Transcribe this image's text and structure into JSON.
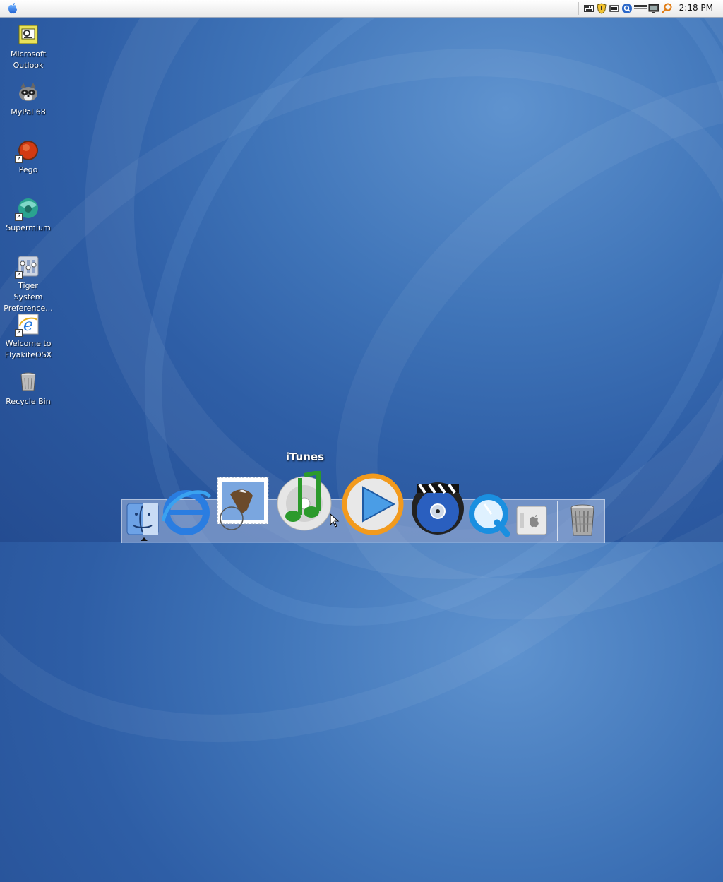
{
  "menubar": {
    "clock": "2:18 PM",
    "tray_icons": [
      "keyboard-icon",
      "shield-icon",
      "battery-icon",
      "search-icon",
      "minimize-bar-icon",
      "monitor-icon",
      "key-icon"
    ]
  },
  "desktop": {
    "icons": [
      {
        "name": "outlook",
        "label": "Microsoft Outlook"
      },
      {
        "name": "mypal",
        "label": "MyPal 68"
      },
      {
        "name": "pego",
        "label": "Pego"
      },
      {
        "name": "supermium",
        "label": "Supermium"
      },
      {
        "name": "tiger-prefs",
        "label": "Tiger System Preference..."
      },
      {
        "name": "welcome",
        "label": "Welcome to FlyakiteOSX"
      },
      {
        "name": "recycle-bin",
        "label": "Recycle Bin"
      }
    ]
  },
  "dock": {
    "hover_label": "iTunes",
    "items": [
      "finder-icon",
      "internet-explorer-icon",
      "mail-icon",
      "itunes-icon",
      "media-player-icon",
      "dvd-player-icon",
      "quicktime-icon",
      "system-icon",
      "trash-icon"
    ]
  },
  "colors": {
    "desktop_blue": "#3f74b8",
    "accent": "#2a67c9"
  }
}
